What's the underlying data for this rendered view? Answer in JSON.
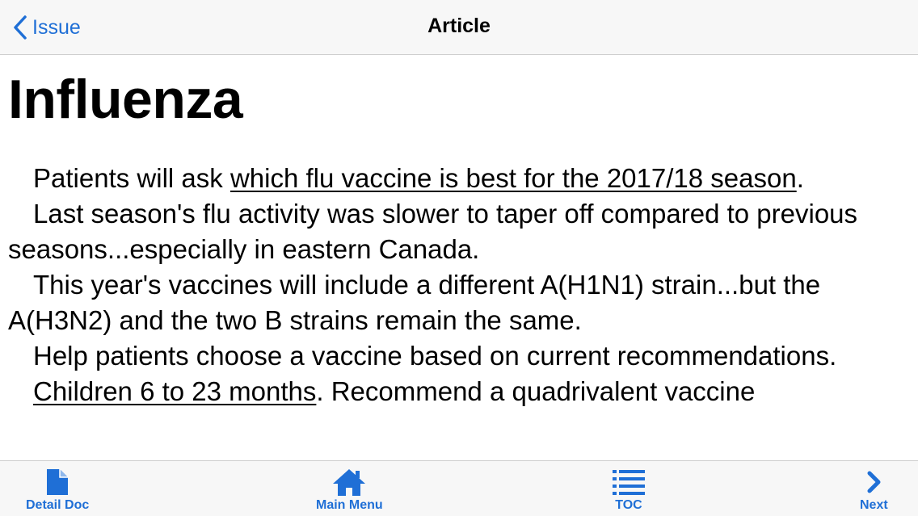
{
  "navbar": {
    "back_label": "Issue",
    "title": "Article"
  },
  "article": {
    "title": "Influenza",
    "p1_before": "Patients will ask ",
    "p1_link": "which flu vaccine is best for the 2017/18 season",
    "p1_after": ".",
    "p2": "Last season's flu activity was slower to taper off compared to previous seasons...especially in eastern Canada.",
    "p3": "This year's vaccines will include a different A(H1N1) strain...but the A(H3N2) and the two B strains remain the same.",
    "p4": "Help patients choose a vaccine based on current recommendations.",
    "p5_link": "Children 6 to 23 months",
    "p5_after": ". Recommend a quadrivalent vaccine"
  },
  "tabbar": {
    "detail_doc": "Detail Doc",
    "main_menu": "Main Menu",
    "toc": "TOC",
    "next": "Next"
  },
  "colors": {
    "accent": "#1f6fd6",
    "bar_background": "#f7f7f7"
  },
  "icons": {
    "back": "chevron-left-icon",
    "detail_doc": "document-icon",
    "main_menu": "home-icon",
    "toc": "list-icon",
    "next": "chevron-right-icon"
  }
}
